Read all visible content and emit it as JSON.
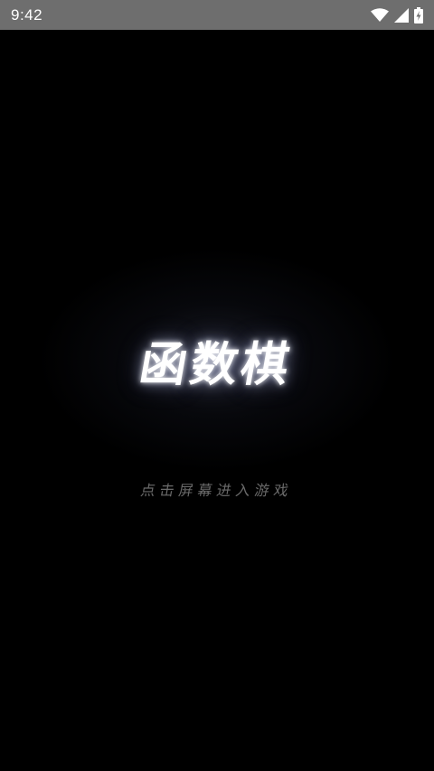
{
  "status_bar": {
    "time": "9:42",
    "icons": [
      "wifi-icon",
      "cell-signal-icon",
      "battery-charging-icon"
    ],
    "background": "#6e6e6e"
  },
  "game": {
    "title": "函数棋",
    "tap_hint": "点击屏幕进入游戏",
    "background": "#000000",
    "title_color": "#ffffff",
    "hint_color": "#6a6a6a"
  }
}
